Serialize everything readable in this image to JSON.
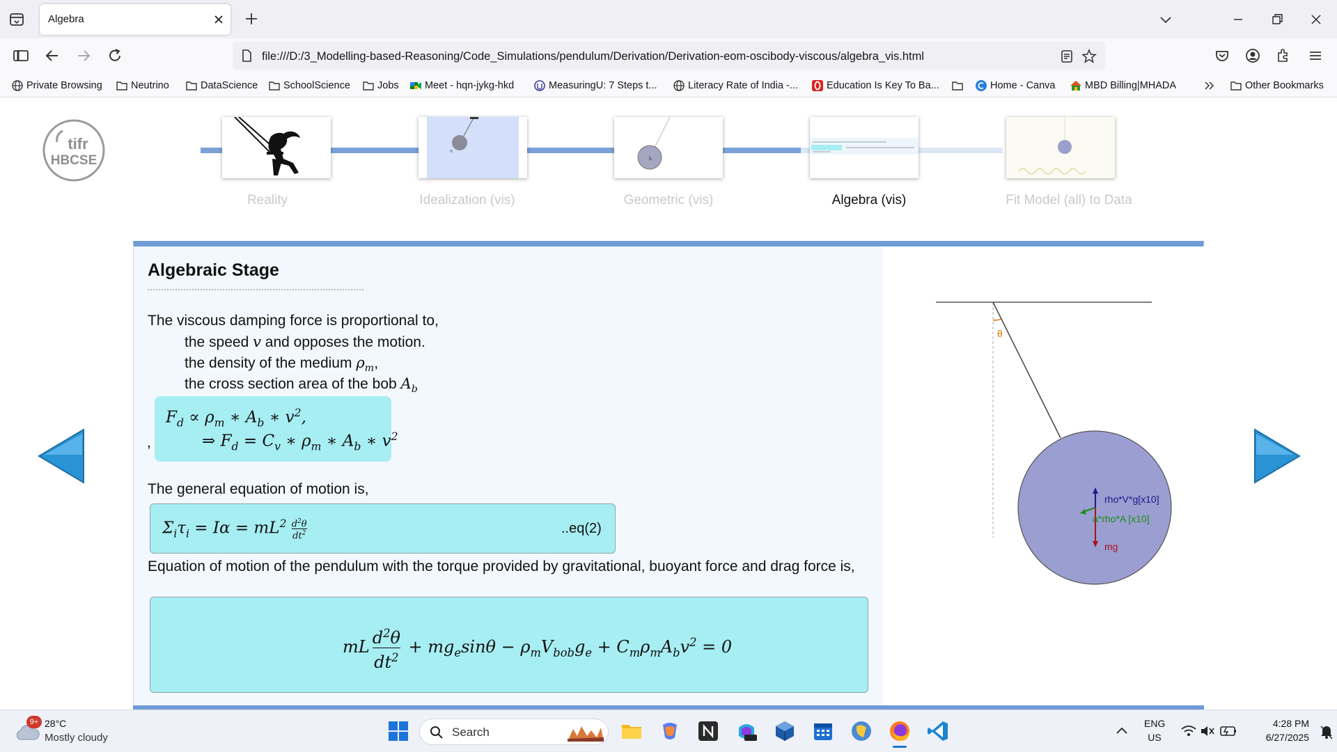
{
  "browser": {
    "tab_title": "Algebra",
    "url": "file:///D:/3_Modelling-based-Reasoning/Code_Simulations/pendulum/Derivation/Derivation-eom-oscibody-viscous/algebra_vis.html",
    "bookmarks": [
      {
        "label": "Private Browsing",
        "icon": "globe-icon"
      },
      {
        "label": "Neutrino",
        "icon": "folder-icon"
      },
      {
        "label": "DataScience",
        "icon": "folder-icon"
      },
      {
        "label": "SchoolScience",
        "icon": "folder-icon"
      },
      {
        "label": "Jobs",
        "icon": "folder-icon"
      },
      {
        "label": "Meet - hqn-jykg-hkd",
        "icon": "meet-icon"
      },
      {
        "label": "MeasuringU: 7 Steps t...",
        "icon": "measuringu-icon"
      },
      {
        "label": "Literacy Rate of India -...",
        "icon": "globe-icon"
      },
      {
        "label": "Education Is Key To Ba...",
        "icon": "opera-icon"
      },
      {
        "label": "",
        "icon": "folder-icon"
      },
      {
        "label": "Home - Canva",
        "icon": "canva-icon"
      },
      {
        "label": "MBD Billing|MHADA",
        "icon": "house-icon"
      }
    ],
    "other_bookmarks": "Other Bookmarks"
  },
  "stages": [
    {
      "label": "Reality",
      "active": false
    },
    {
      "label": "Idealization (vis)",
      "active": false
    },
    {
      "label": "Geometric (vis)",
      "active": false
    },
    {
      "label": "Algebra (vis)",
      "active": true
    },
    {
      "label": "Fit Model (all) to Data",
      "active": false
    }
  ],
  "logo": {
    "line1": "tifr",
    "line2": "HBCSE"
  },
  "content": {
    "title": "Algebraic Stage",
    "intro": "The viscous damping force is proportional to,",
    "bullets": {
      "speed_pre": "the speed ",
      "speed_var": "v",
      "speed_post": " and opposes the motion.",
      "density_pre": "the density of the medium ",
      "density_var": "ρ",
      "density_sub": "m",
      "density_post": ",",
      "area_pre": "the cross section area of the bob ",
      "area_var": "A",
      "area_sub": "b"
    },
    "comma": ",",
    "general_eq_intro": "The general equation of motion is,",
    "eq_tag": "..eq(2)",
    "eom_intro": "Equation of motion of the pendulum with the torque provided by gravitational, buoyant force and drag force is,"
  },
  "diagram": {
    "theta_label": "θ",
    "force_labels": {
      "buoyancy": "rho*V*g[x10]",
      "drag": "a*rho*A [x10]",
      "weight": "mg"
    },
    "colors": {
      "bob": "#9a9ed0",
      "buoyancy": "#1a1a8c",
      "drag": "#1a8c1a",
      "weight": "#b01020",
      "theta": "#e07000"
    }
  },
  "taskbar": {
    "weather_temp": "28°C",
    "weather_desc": "Mostly cloudy",
    "weather_badge": "9+",
    "search_placeholder": "Search",
    "lang_top": "ENG",
    "lang_bottom": "US",
    "time": "4:28 PM",
    "date": "6/27/2025"
  }
}
